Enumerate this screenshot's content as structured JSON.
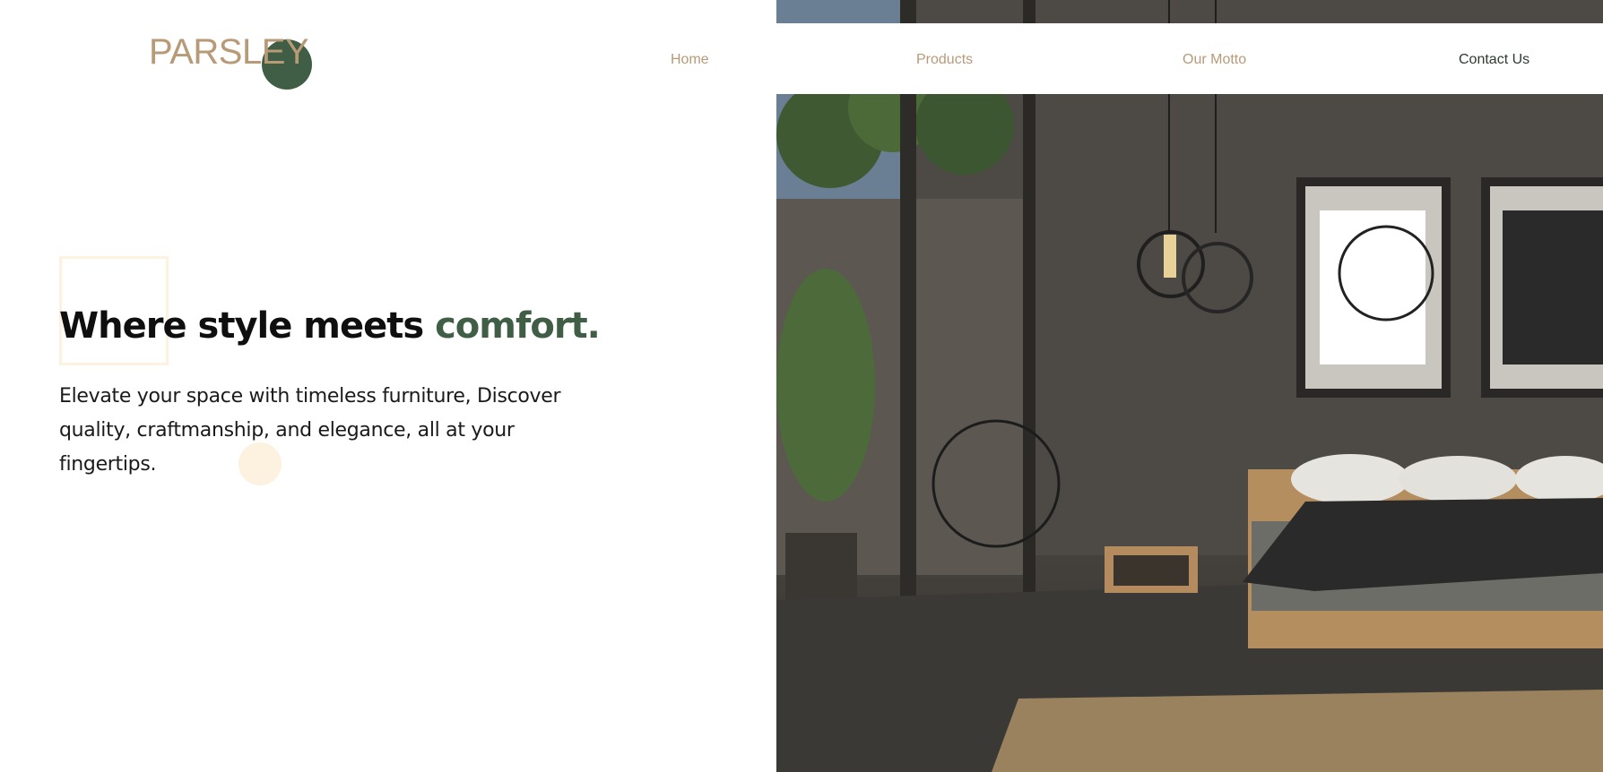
{
  "brand": {
    "logo_text": "PARSLEY",
    "logo_dot_color": "#3f5e45",
    "logo_text_color": "#b89a77"
  },
  "nav": {
    "items": [
      {
        "label": "Home"
      },
      {
        "label": "Products"
      },
      {
        "label": "Our Motto"
      },
      {
        "label": "Contact Us"
      }
    ]
  },
  "hero": {
    "headline_main": "Where style meets ",
    "headline_accent": "comfort.",
    "accent_color": "#3f5e45",
    "subtext": "Elevate your space with timeless furniture, Discover quality, craftmanship, and elegance, all at your fingertips.",
    "image_subject": "modern bedroom interior with bed, pendant lights, framed art and glass wall"
  }
}
